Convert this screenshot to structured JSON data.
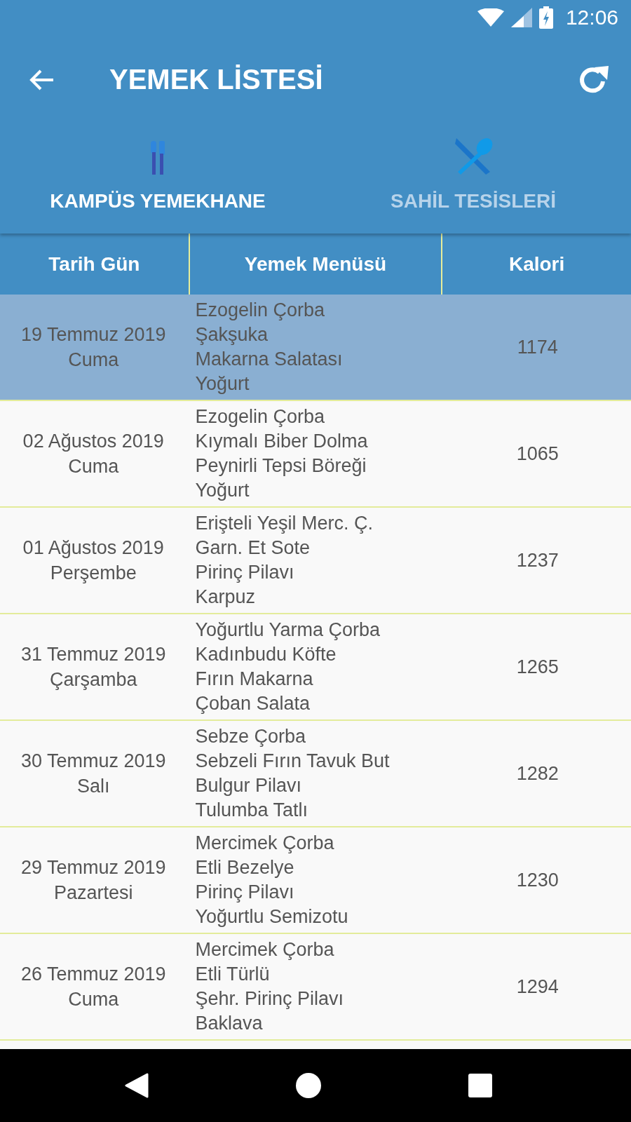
{
  "status_bar": {
    "time": "12:06"
  },
  "toolbar": {
    "title": "YEMEK LİSTESİ"
  },
  "tabs": [
    {
      "label": "KAMPÜS YEMEKHANE",
      "selected": true,
      "kind": "fork"
    },
    {
      "label": "SAHİL TESİSLERİ",
      "selected": false,
      "kind": "cross"
    }
  ],
  "table": {
    "columns": [
      "Tarih Gün",
      "Yemek Menüsü",
      "Kalori"
    ],
    "rows": [
      {
        "date": "19 Temmuz 2019",
        "day": "Cuma",
        "menu": [
          "Ezogelin Çorba",
          "Şakşuka",
          "Makarna Salatası",
          "Yoğurt"
        ],
        "calories": "1174",
        "selected": true
      },
      {
        "date": "02 Ağustos 2019",
        "day": "Cuma",
        "menu": [
          "Ezogelin Çorba",
          "Kıymalı Biber Dolma",
          "Peynirli Tepsi Böreği",
          "Yoğurt"
        ],
        "calories": "1065",
        "selected": false
      },
      {
        "date": "01 Ağustos 2019",
        "day": "Perşembe",
        "menu": [
          "Erişteli Yeşil Merc. Ç.",
          "Garn. Et Sote",
          "Pirinç Pilavı",
          "Karpuz"
        ],
        "calories": "1237",
        "selected": false
      },
      {
        "date": "31 Temmuz 2019",
        "day": "Çarşamba",
        "menu": [
          "Yoğurtlu Yarma Çorba",
          "Kadınbudu Köfte",
          "Fırın Makarna",
          "Çoban Salata"
        ],
        "calories": "1265",
        "selected": false
      },
      {
        "date": "30 Temmuz 2019",
        "day": "Salı",
        "menu": [
          "Sebze Çorba",
          "Sebzeli Fırın Tavuk But",
          "Bulgur Pilavı",
          "Tulumba Tatlı"
        ],
        "calories": "1282",
        "selected": false
      },
      {
        "date": "29 Temmuz 2019",
        "day": "Pazartesi",
        "menu": [
          "Mercimek Çorba",
          "Etli Bezelye",
          "Pirinç Pilavı",
          "Yoğurtlu Semizotu"
        ],
        "calories": "1230",
        "selected": false
      },
      {
        "date": "26 Temmuz 2019",
        "day": "Cuma",
        "menu": [
          "Mercimek Çorba",
          "Etli Türlü",
          "Şehr. Pirinç Pilavı",
          "Baklava"
        ],
        "calories": "1294",
        "selected": false
      }
    ]
  }
}
